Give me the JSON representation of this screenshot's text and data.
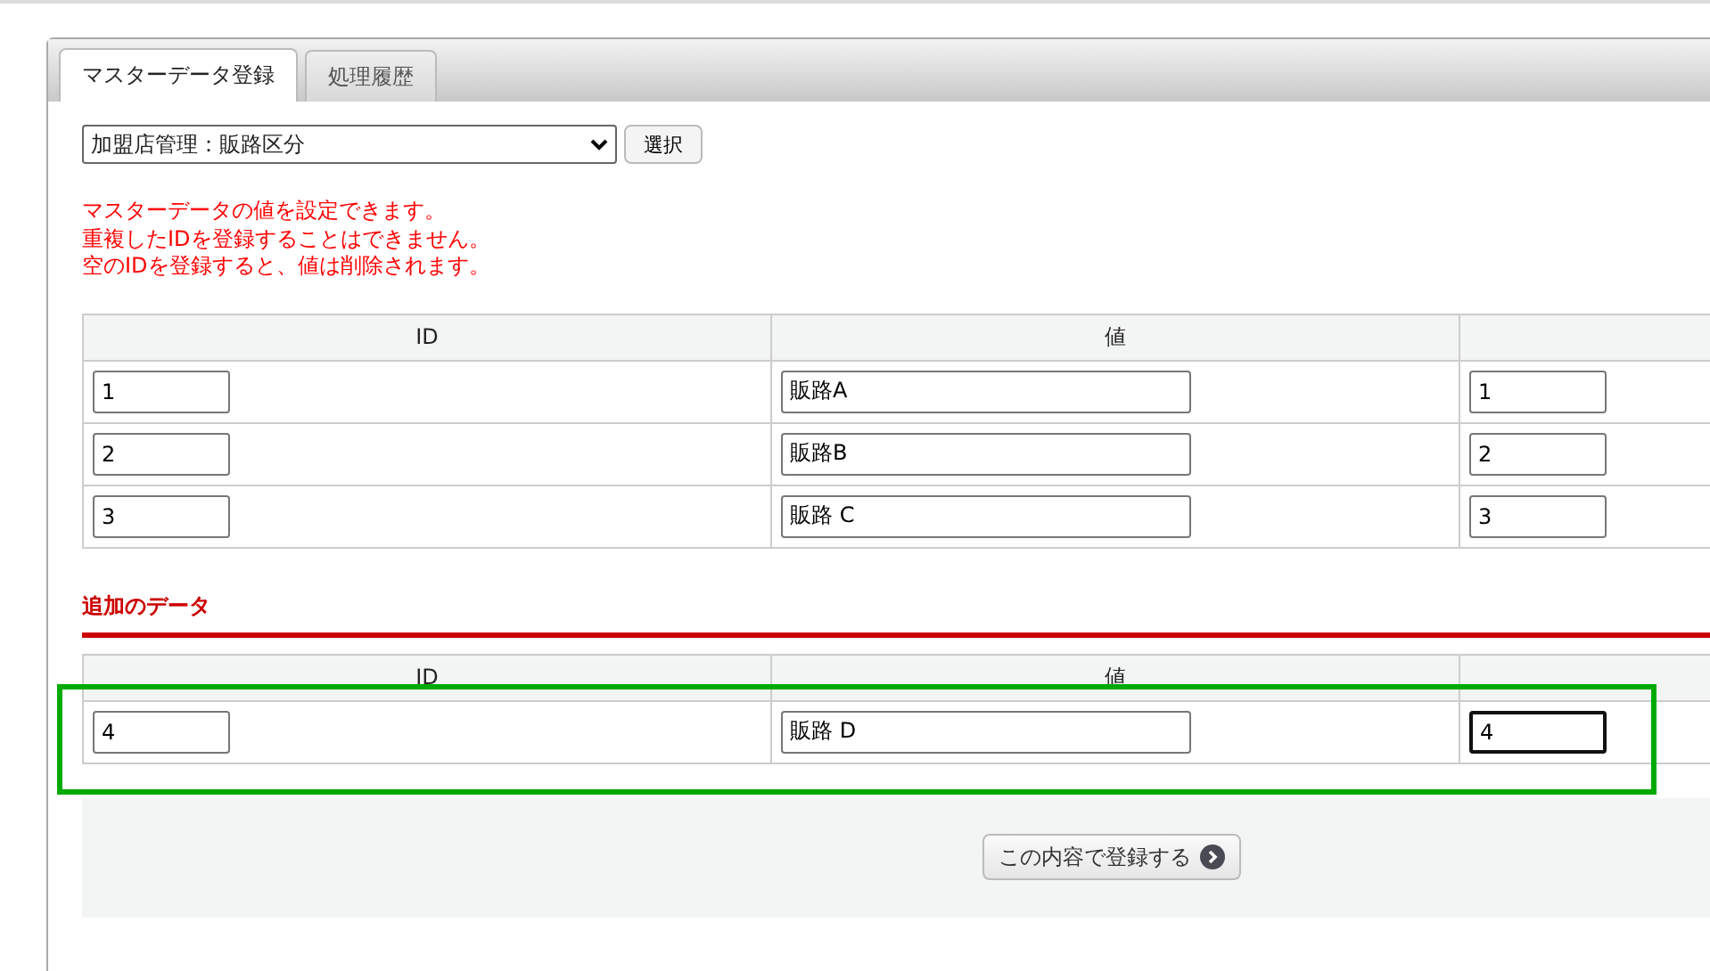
{
  "tabs": [
    {
      "label": "マスターデータ登録",
      "selected": true
    },
    {
      "label": "処理履歴",
      "selected": false
    }
  ],
  "master_select": {
    "value": "加盟店管理：販路区分"
  },
  "select_button": "選択",
  "notes": [
    "マスターデータの値を設定できます。",
    "重複したIDを登録することはできません。",
    "空のIDを登録すると、値は削除されます。"
  ],
  "table": {
    "columns": [
      "ID",
      "値"
    ],
    "rows": [
      {
        "id": "1",
        "value": "販路A",
        "order": "1",
        "focused": false
      },
      {
        "id": "2",
        "value": "販路B",
        "order": "2",
        "focused": false
      },
      {
        "id": "3",
        "value": "販路 C",
        "order": "3",
        "focused": false
      }
    ]
  },
  "added_section": {
    "title": "追加のデータ",
    "columns": [
      "ID",
      "値"
    ],
    "rows": [
      {
        "id": "4",
        "value": "販路 D",
        "order": "4",
        "focused": true
      }
    ],
    "highlighted": true
  },
  "submit_button": "この内容で登録する"
}
